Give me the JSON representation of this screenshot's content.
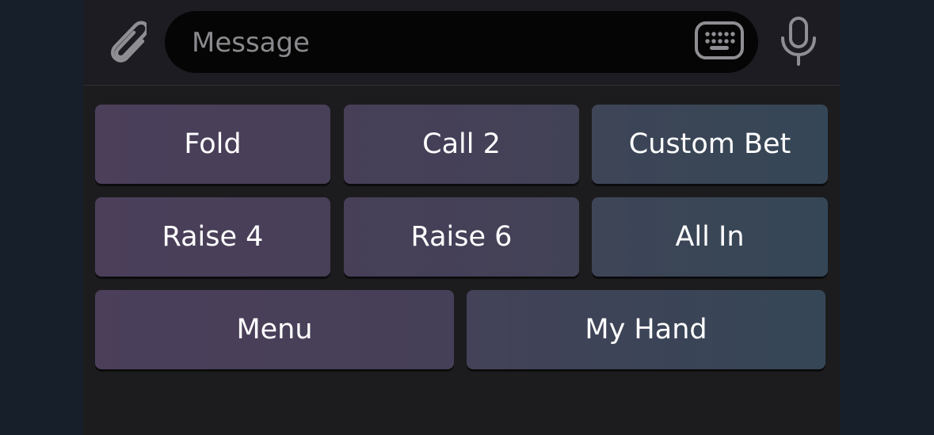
{
  "colors": {
    "outer_background": "#17202a",
    "panel_background": "#1c1c1e",
    "input_bar_background": "#1d1c22",
    "message_field_background": "#050505",
    "placeholder_text": "#8a8a8e",
    "icon_color": "#8e8e93",
    "key_text": "#ffffff",
    "key_gradient_start": "#4b3f5a",
    "key_gradient_end": "#354656"
  },
  "input_bar": {
    "attach_icon": "paperclip-icon",
    "message_value": "",
    "message_placeholder": "Message",
    "keyboard_icon": "keyboard-icon",
    "mic_icon": "microphone-icon"
  },
  "keyboard": {
    "rows": [
      [
        "Fold",
        "Call 2",
        "Custom Bet"
      ],
      [
        "Raise 4",
        "Raise 6",
        "All In"
      ],
      [
        "Menu",
        "My Hand"
      ]
    ]
  }
}
